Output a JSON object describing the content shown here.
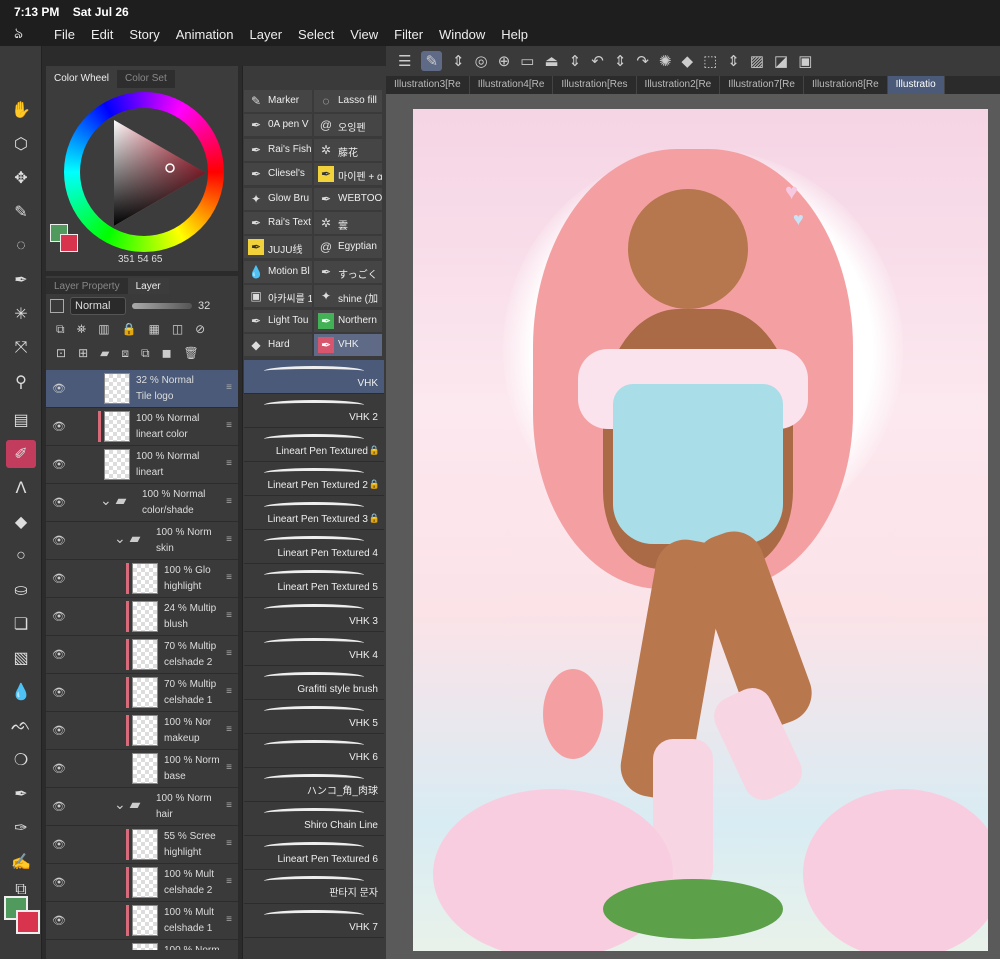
{
  "status": {
    "time": "7:13 PM",
    "date": "Sat Jul 26"
  },
  "menu": [
    "File",
    "Edit",
    "Story",
    "Animation",
    "Layer",
    "Select",
    "View",
    "Filter",
    "Window",
    "Help"
  ],
  "color_panel": {
    "tabs": [
      "Color Wheel",
      "Color Set"
    ],
    "readout": "351  54  65",
    "fg_color": "#4f9a5c",
    "bg_color": "#d8344e"
  },
  "layer_panel": {
    "tabs": [
      "Layer Property",
      "Layer"
    ],
    "blend_mode": "Normal",
    "opacity": "32",
    "layers": [
      {
        "l1": "32 % Normal",
        "l2": "Tile logo",
        "indent": 0,
        "type": "layer",
        "selected": true
      },
      {
        "l1": "100 % Normal",
        "l2": "lineart color",
        "indent": 0,
        "type": "layer",
        "clip": true
      },
      {
        "l1": "100 % Normal",
        "l2": "lineart",
        "indent": 0,
        "type": "layer"
      },
      {
        "l1": "100 % Normal",
        "l2": "color/shade",
        "indent": 0,
        "type": "folder"
      },
      {
        "l1": "100 % Norm",
        "l2": "skin",
        "indent": 1,
        "type": "folder"
      },
      {
        "l1": "100 % Glo",
        "l2": "highlight",
        "indent": 2,
        "type": "layer",
        "clip": true
      },
      {
        "l1": "24 % Multip",
        "l2": "blush",
        "indent": 2,
        "type": "layer",
        "clip": true
      },
      {
        "l1": "70 % Multip",
        "l2": "celshade 2",
        "indent": 2,
        "type": "layer",
        "clip": true
      },
      {
        "l1": "70 % Multip",
        "l2": "celshade 1",
        "indent": 2,
        "type": "layer",
        "clip": true
      },
      {
        "l1": "100 % Nor",
        "l2": "makeup",
        "indent": 2,
        "type": "layer",
        "clip": true
      },
      {
        "l1": "100 % Norm",
        "l2": "base",
        "indent": 2,
        "type": "layer"
      },
      {
        "l1": "100 % Norm",
        "l2": "hair",
        "indent": 1,
        "type": "folder"
      },
      {
        "l1": "55 % Scree",
        "l2": "highlight",
        "indent": 2,
        "type": "layer",
        "clip": true
      },
      {
        "l1": "100 % Mult",
        "l2": "celshade 2",
        "indent": 2,
        "type": "layer",
        "clip": true
      },
      {
        "l1": "100 % Mult",
        "l2": "celshade 1",
        "indent": 2,
        "type": "layer",
        "clip": true
      },
      {
        "l1": "100 % Norm",
        "l2": "",
        "indent": 2,
        "type": "layer"
      }
    ]
  },
  "subtools": [
    {
      "name": "Marker",
      "icon": "marker-icon"
    },
    {
      "name": "Lasso fill",
      "icon": "lasso-icon"
    },
    {
      "name": "0A pen V",
      "icon": "pen-icon"
    },
    {
      "name": "오잉펜",
      "icon": "swirl-icon"
    },
    {
      "name": "Rai's Fish",
      "icon": "pen-icon"
    },
    {
      "name": "藤花",
      "icon": "gear-icon"
    },
    {
      "name": "Cliesel's",
      "icon": "pen-icon"
    },
    {
      "name": "마이펜 + α",
      "icon": "pen-icon",
      "style": "yellow"
    },
    {
      "name": "Glow Bru",
      "icon": "sparkle-icon"
    },
    {
      "name": "WEBTOO",
      "icon": "pen-icon"
    },
    {
      "name": "Rai's Text",
      "icon": "pen-icon"
    },
    {
      "name": "雲",
      "icon": "gear-icon"
    },
    {
      "name": "JUJU线",
      "icon": "pen-icon",
      "style": "yellow"
    },
    {
      "name": "Egyptian",
      "icon": "swirl-icon"
    },
    {
      "name": "Motion Bl",
      "icon": "drop-icon"
    },
    {
      "name": "すっごく",
      "icon": "pen-icon"
    },
    {
      "name": "아카씨를 1",
      "icon": "frame-icon"
    },
    {
      "name": "shine (加",
      "icon": "sparkle-icon"
    },
    {
      "name": "Light Tou",
      "icon": "pen-icon"
    },
    {
      "name": "Northern",
      "icon": "pen-icon",
      "style": "green"
    },
    {
      "name": "Hard",
      "icon": "eraser-icon"
    },
    {
      "name": "VHK",
      "icon": "pen-icon",
      "style": "pink",
      "active": true
    }
  ],
  "brushes": [
    {
      "name": "VHK",
      "active": true
    },
    {
      "name": "VHK 2"
    },
    {
      "name": "Lineart Pen Textured",
      "locked": true
    },
    {
      "name": "Lineart Pen Textured 2",
      "locked": true
    },
    {
      "name": "Lineart Pen Textured 3",
      "locked": true
    },
    {
      "name": "Lineart Pen Textured 4"
    },
    {
      "name": "Lineart Pen Textured 5"
    },
    {
      "name": "VHK 3"
    },
    {
      "name": "VHK 4"
    },
    {
      "name": "Grafitti style brush"
    },
    {
      "name": "VHK 5"
    },
    {
      "name": "VHK 6"
    },
    {
      "name": "ハンコ_角_肉球"
    },
    {
      "name": "Shiro Chain Line"
    },
    {
      "name": "Lineart Pen Textured 6"
    },
    {
      "name": "판타지 문자"
    },
    {
      "name": "VHK 7"
    }
  ],
  "doc_tabs": [
    {
      "name": "Illustration3[Re"
    },
    {
      "name": "Illustration4[Re"
    },
    {
      "name": "Illustration[Res"
    },
    {
      "name": "Illustration2[Re"
    },
    {
      "name": "Illustration7[Re"
    },
    {
      "name": "Illustration8[Re"
    },
    {
      "name": "Illustratio",
      "active": true
    }
  ]
}
